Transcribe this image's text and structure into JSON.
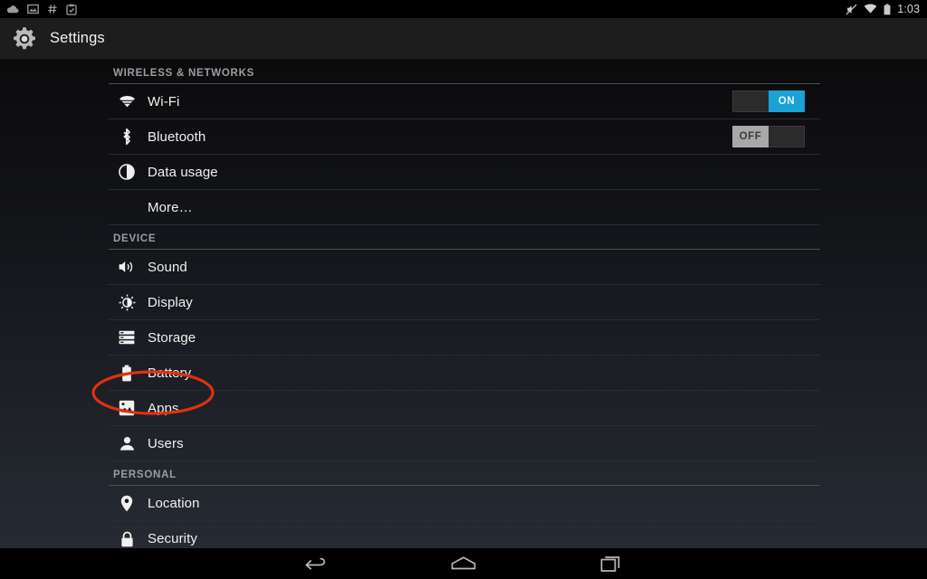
{
  "status_bar": {
    "notification_icons": [
      "cloud-icon",
      "screenshot-image-icon",
      "hash-icon",
      "clipboard-icon"
    ],
    "system_icons": [
      "mute-icon",
      "wifi-icon",
      "battery-icon"
    ],
    "clock": "1:03"
  },
  "action_bar": {
    "icon": "settings-gear-icon",
    "title": "Settings"
  },
  "colors": {
    "accent_on": "#1ba1d4",
    "annotation_red": "#e03010",
    "section_header_text": "#9a9da2"
  },
  "sections": [
    {
      "header": "WIRELESS & NETWORKS",
      "items": [
        {
          "label": "Wi-Fi",
          "icon": "wifi-icon",
          "toggle": "ON",
          "toggle_state": "on"
        },
        {
          "label": "Bluetooth",
          "icon": "bluetooth-icon",
          "toggle": "OFF",
          "toggle_state": "off"
        },
        {
          "label": "Data usage",
          "icon": "data-usage-icon"
        },
        {
          "label": "More…",
          "icon": null
        }
      ]
    },
    {
      "header": "DEVICE",
      "items": [
        {
          "label": "Sound",
          "icon": "sound-speaker-icon"
        },
        {
          "label": "Display",
          "icon": "display-brightness-icon"
        },
        {
          "label": "Storage",
          "icon": "storage-disks-icon",
          "annotated": true
        },
        {
          "label": "Battery",
          "icon": "battery-icon"
        },
        {
          "label": "Apps",
          "icon": "apps-image-icon"
        },
        {
          "label": "Users",
          "icon": "users-person-icon"
        }
      ]
    },
    {
      "header": "PERSONAL",
      "items": [
        {
          "label": "Location",
          "icon": "location-pin-icon"
        },
        {
          "label": "Security",
          "icon": "lock-icon"
        }
      ]
    }
  ],
  "nav_bar": {
    "buttons": [
      "back-icon",
      "home-icon",
      "recents-icon"
    ]
  }
}
